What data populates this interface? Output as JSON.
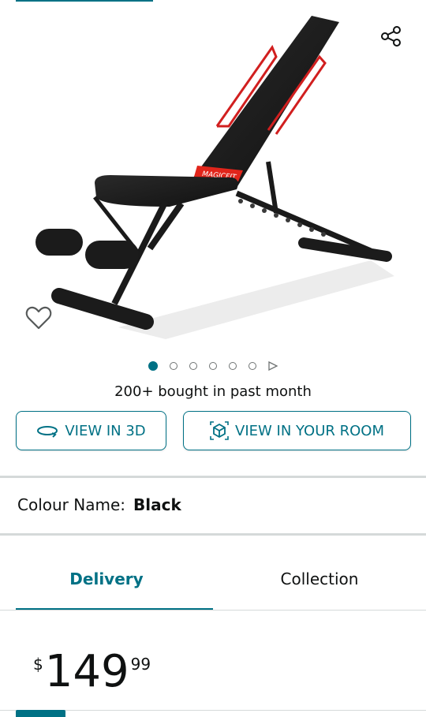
{
  "product": {
    "brand_on_image": "MAGICFIT",
    "image_dots_total": 6,
    "image_dots_active": 1
  },
  "social_proof": {
    "bought_text": "200+ bought in past month"
  },
  "actions": {
    "view_3d_label": "VIEW IN 3D",
    "view_room_label": "VIEW IN YOUR ROOM"
  },
  "colour": {
    "label": "Colour Name:",
    "value": "Black"
  },
  "tabs": [
    {
      "label": "Delivery",
      "active": true
    },
    {
      "label": "Collection",
      "active": false
    }
  ],
  "price": {
    "symbol": "$",
    "whole": "149",
    "fraction": "99"
  },
  "icons": {
    "share": "share-icon",
    "wishlist": "heart-icon",
    "view_3d": "rotate-3d-icon",
    "view_room": "cube-ar-icon",
    "play": "play-icon"
  },
  "colors": {
    "accent": "#007185",
    "text": "#0f1111",
    "divider": "#d5d9d9",
    "brand_red": "#e1251b"
  }
}
